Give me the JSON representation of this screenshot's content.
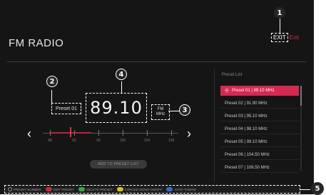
{
  "screen": {
    "title": "FM RADIO",
    "exit": {
      "key": "EXIT",
      "label": "Exit"
    },
    "preset_name": "Preset 01",
    "frequency": "89.10",
    "band_line1": "FM",
    "band_line2": "MHz",
    "tuner_numbers": [
      "88",
      "92",
      "96",
      "100",
      "104",
      "108"
    ],
    "add_button_label": "ADD TO PRESET LIST",
    "preset_list_label": "Preset List",
    "presets": [
      {
        "label": "Preset 01 | 89.10 MHz",
        "selected": true
      },
      {
        "label": "Preset 02 | 91.90 MHz"
      },
      {
        "label": "Preset 03 | 95.10 MHz"
      },
      {
        "label": "Preset 04 | 98.10 MHz"
      },
      {
        "label": "Preset 05 | 99.10 MHz"
      },
      {
        "label": "Preset 06 | 104.50 MHz"
      },
      {
        "label": "Preset 07 | 106.50 MHz"
      }
    ],
    "bottom_bar": [
      {
        "label": "PRESET NUMBER",
        "color": "#9a9a9a",
        "icon": "number-key-icon"
      },
      {
        "label": "EDIT PRESET",
        "color": "#c8283c",
        "icon": "red-key-icon"
      },
      {
        "label": "DELETE PRESET",
        "color": "#3aa54a",
        "icon": "green-key-icon"
      },
      {
        "label": "FORCED MONO ON/OFF",
        "color": "#d8c21e",
        "icon": "yellow-key-icon"
      },
      {
        "label": "AUTO TUNING",
        "color": "#2f6fd0",
        "icon": "blue-key-icon"
      }
    ],
    "accent": "#d42a51"
  },
  "callouts": [
    "1",
    "2",
    "3",
    "4",
    "5"
  ]
}
